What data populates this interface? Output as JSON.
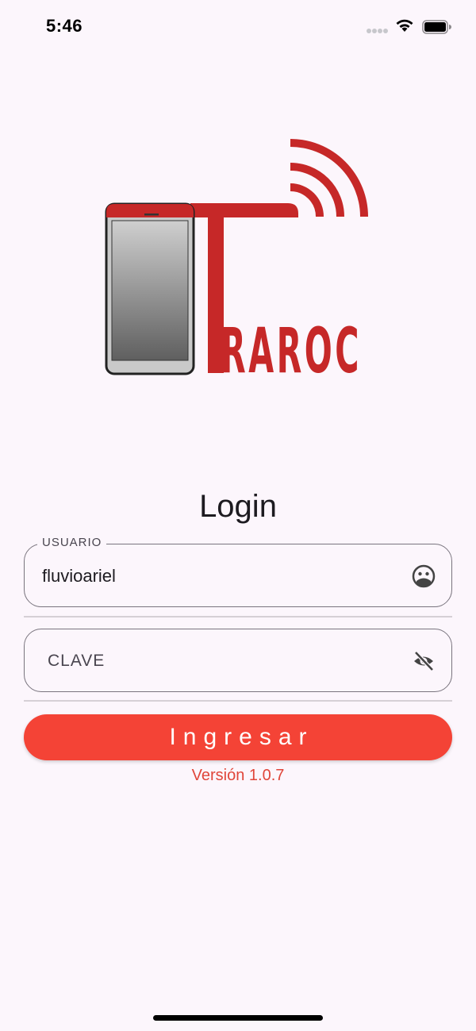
{
  "status_bar": {
    "time": "5:46"
  },
  "logo": {
    "text": "RAROC",
    "color": "#c62828"
  },
  "login": {
    "title": "Login",
    "username": {
      "label": "USUARIO",
      "value": "fluvioariel",
      "icon": "face-icon"
    },
    "password": {
      "placeholder": "CLAVE",
      "icon": "visibility-off-icon"
    },
    "submit_label": "Ingresar",
    "version": "Versión 1.0.7"
  },
  "colors": {
    "background": "#fcf6fc",
    "accent": "#f44336",
    "brand": "#c62828"
  }
}
